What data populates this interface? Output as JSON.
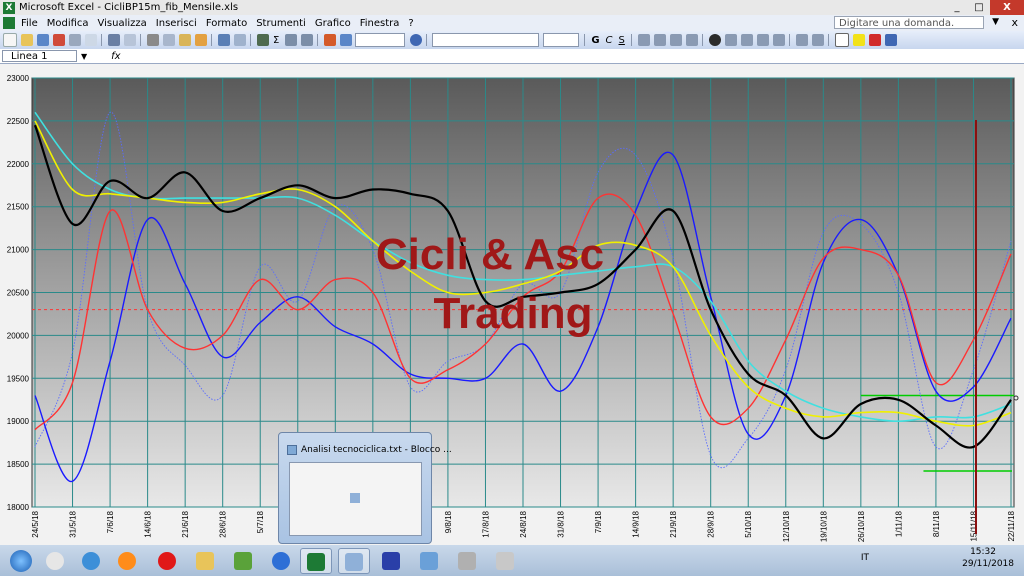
{
  "window": {
    "title": "Microsoft Excel - CicliBP15m_fib_Mensile.xls",
    "controls": [
      "_",
      "□",
      "X"
    ]
  },
  "menu": {
    "items": [
      "File",
      "Modifica",
      "Visualizza",
      "Inserisci",
      "Formato",
      "Strumenti",
      "Grafico",
      "Finestra",
      "?"
    ],
    "ask_placeholder": "Digitare una domanda.",
    "doc_close": "x"
  },
  "toolbar": {
    "bold": "G",
    "italic": "C",
    "underline": "S",
    "sum": "Σ"
  },
  "formula_bar": {
    "name_box": "Linea 1",
    "fx": "fx"
  },
  "chart_data": {
    "type": "line",
    "watermark": [
      "Cicli & Asc",
      "Trading"
    ],
    "ylim": [
      18000,
      23000
    ],
    "y_ticks": [
      18000,
      18500,
      19000,
      19500,
      20000,
      20500,
      21000,
      21500,
      22000,
      22500,
      23000
    ],
    "x_tick_labels": [
      "24/5/18",
      "31/5/18",
      "7/6/18",
      "14/6/18",
      "21/6/18",
      "28/6/18",
      "5/7/18",
      "12/7/18",
      "19/7/18",
      "26/7/18",
      "2/8/18",
      "9/8/18",
      "17/8/18",
      "24/8/18",
      "31/8/18",
      "7/9/18",
      "14/9/18",
      "21/9/18",
      "28/9/18",
      "5/10/18",
      "12/10/18",
      "19/10/18",
      "26/10/18",
      "1/11/18",
      "8/11/18",
      "15/11/18",
      "22/11/18"
    ],
    "grid": true,
    "colors": {
      "price": "#000000",
      "smooth_cyan": "#40e0e0",
      "smooth_yellow": "#f0f000",
      "cycle_red": "#ff3333",
      "cycle_blue": "#1a1aff",
      "oscillator_dotted": "#5a6cff",
      "reference_red_dotted": "#ff3333",
      "reference_green": "#00cc00",
      "cursor_line": "#8b1010"
    },
    "series": [
      {
        "key": "price",
        "x": [
          0,
          1,
          2,
          3,
          4,
          5,
          6,
          7,
          8,
          9,
          10,
          11,
          12,
          13,
          14,
          15,
          16,
          17,
          18,
          19,
          20,
          21,
          22,
          23,
          24,
          25,
          26
        ],
        "y": [
          22450,
          21300,
          21800,
          21600,
          21900,
          21450,
          21600,
          21750,
          21600,
          21700,
          21650,
          21450,
          20400,
          20450,
          20500,
          20600,
          21000,
          21450,
          20300,
          19550,
          19300,
          18800,
          19200,
          19250,
          18950,
          18700,
          19250
        ]
      },
      {
        "key": "smooth_cyan",
        "x": [
          0,
          1,
          2,
          3,
          4,
          5,
          6,
          7,
          8,
          9,
          10,
          11,
          12,
          13,
          14,
          15,
          16,
          17,
          18,
          19,
          20,
          21,
          22,
          23,
          24,
          25,
          26
        ],
        "y": [
          22600,
          22000,
          21700,
          21600,
          21600,
          21600,
          21600,
          21600,
          21400,
          21100,
          20850,
          20700,
          20650,
          20650,
          20700,
          20750,
          20800,
          20800,
          20400,
          19700,
          19350,
          19150,
          19050,
          19000,
          19050,
          19050,
          19200
        ]
      },
      {
        "key": "smooth_yellow",
        "x": [
          0,
          1,
          2,
          3,
          4,
          5,
          6,
          7,
          8,
          9,
          10,
          11,
          12,
          13,
          14,
          15,
          16,
          17,
          18,
          19,
          20,
          21,
          22,
          23,
          24,
          25,
          26
        ],
        "y": [
          22500,
          21700,
          21650,
          21600,
          21550,
          21550,
          21650,
          21700,
          21500,
          21100,
          20750,
          20500,
          20500,
          20600,
          20750,
          21050,
          21050,
          20800,
          20000,
          19400,
          19150,
          19050,
          19100,
          19100,
          19000,
          18950,
          19100
        ]
      },
      {
        "key": "cycle_red",
        "x": [
          0,
          1,
          2,
          3,
          4,
          5,
          6,
          7,
          8,
          9,
          10,
          11,
          12,
          13,
          14,
          15,
          16,
          17,
          18,
          19,
          20,
          21,
          22,
          23,
          24,
          25,
          26
        ],
        "y": [
          18900,
          19450,
          21450,
          20300,
          19850,
          20000,
          20650,
          20300,
          20650,
          20500,
          19500,
          19600,
          19900,
          20450,
          20750,
          21600,
          21400,
          20250,
          19050,
          19150,
          19950,
          20900,
          21000,
          20700,
          19450,
          19950,
          20950
        ]
      },
      {
        "key": "cycle_blue",
        "x": [
          0,
          1,
          2,
          3,
          4,
          5,
          6,
          7,
          8,
          9,
          10,
          11,
          12,
          13,
          14,
          15,
          16,
          17,
          18,
          19,
          20,
          21,
          22,
          23,
          24,
          25,
          26
        ],
        "y": [
          19300,
          18300,
          19700,
          21350,
          20600,
          19750,
          20150,
          20450,
          20100,
          19900,
          19550,
          19500,
          19500,
          19900,
          19350,
          20100,
          21450,
          22100,
          20450,
          18850,
          19300,
          20850,
          21350,
          20700,
          19350,
          19400,
          20200
        ]
      },
      {
        "key": "oscillator_dotted",
        "x": [
          0,
          1,
          2,
          3,
          4,
          5,
          6,
          7,
          8,
          9,
          10,
          11,
          12,
          13,
          14,
          15,
          16,
          17,
          18,
          19,
          20,
          21,
          22,
          23,
          24,
          25,
          26
        ],
        "y": [
          18700,
          19800,
          22600,
          20300,
          19650,
          19300,
          20800,
          20400,
          21500,
          21000,
          19400,
          19700,
          19900,
          20600,
          20500,
          21900,
          22100,
          20900,
          18600,
          18800,
          19600,
          21200,
          21300,
          20500,
          18700,
          19600,
          21100
        ]
      }
    ],
    "reference_lines": [
      {
        "key": "reference_red_dotted",
        "y": 20300
      },
      {
        "key": "reference_green_upper",
        "y": 19300
      },
      {
        "key": "reference_green_lower",
        "y": 18420
      }
    ]
  },
  "taskbar": {
    "preview_title": "Analisi tecnociclica.txt - Blocco ...",
    "language": "IT",
    "time": "15:32",
    "date": "29/11/2018"
  }
}
